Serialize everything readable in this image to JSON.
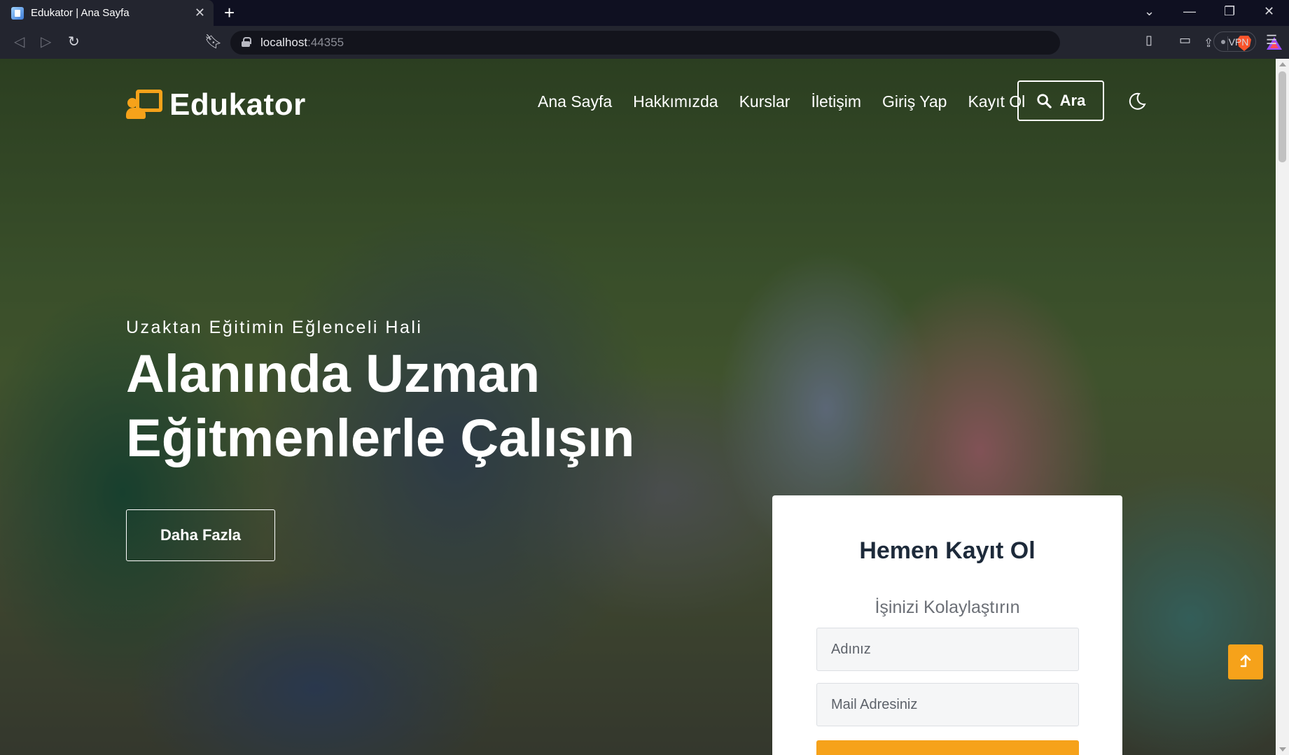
{
  "browser": {
    "tab_title": "Edukator | Ana Sayfa",
    "url_host": "localhost",
    "url_port": ":44355",
    "vpn_label": "VPN"
  },
  "site": {
    "logo_text": "Edukator",
    "nav": [
      "Ana Sayfa",
      "Hakkımızda",
      "Kurslar",
      "İletişim",
      "Giriş Yap",
      "Kayıt Ol"
    ],
    "search_label": "Ara"
  },
  "hero": {
    "subtitle": "Uzaktan Eğitimin Eğlenceli Hali",
    "title_line1": "Alanında Uzman",
    "title_line2": "Eğitmenlerle Çalışın",
    "more_button": "Daha Fazla"
  },
  "signup": {
    "title": "Hemen Kayıt Ol",
    "subtitle": "İşinizi Kolaylaştırın",
    "name_placeholder": "Adınız",
    "email_placeholder": "Mail Adresiniz"
  },
  "colors": {
    "accent": "#f6a21a",
    "heading": "#1d2a3a"
  },
  "icons": [
    "search-icon",
    "moon-icon",
    "scroll-to-top-icon",
    "logo-icon"
  ]
}
